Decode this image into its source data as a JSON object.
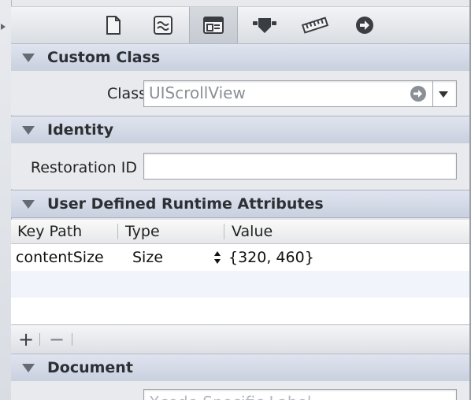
{
  "toolbar": {
    "tabs": [
      {
        "name": "file-inspector-icon"
      },
      {
        "name": "quick-help-icon"
      },
      {
        "name": "identity-inspector-icon"
      },
      {
        "name": "attributes-inspector-icon"
      },
      {
        "name": "size-inspector-icon"
      },
      {
        "name": "connections-inspector-icon"
      }
    ],
    "selected_index": 2
  },
  "custom_class": {
    "header": "Custom Class",
    "class_label": "Class",
    "class_value": "UIScrollView"
  },
  "identity": {
    "header": "Identity",
    "restoration_label": "Restoration ID",
    "restoration_value": ""
  },
  "runtime_attributes": {
    "header": "User Defined Runtime Attributes",
    "columns": [
      "Key Path",
      "Type",
      "Value"
    ],
    "rows": [
      {
        "key_path": "contentSize",
        "type": "Size",
        "value": "{320, 460}"
      }
    ],
    "add_label": "+",
    "remove_label": "−"
  },
  "document": {
    "header": "Document",
    "label_placeholder": "Xcode Specific Label"
  },
  "colors": {
    "header_bg": "#cdd4e2",
    "panel_bg": "#e8eaee",
    "text": "#222222"
  }
}
